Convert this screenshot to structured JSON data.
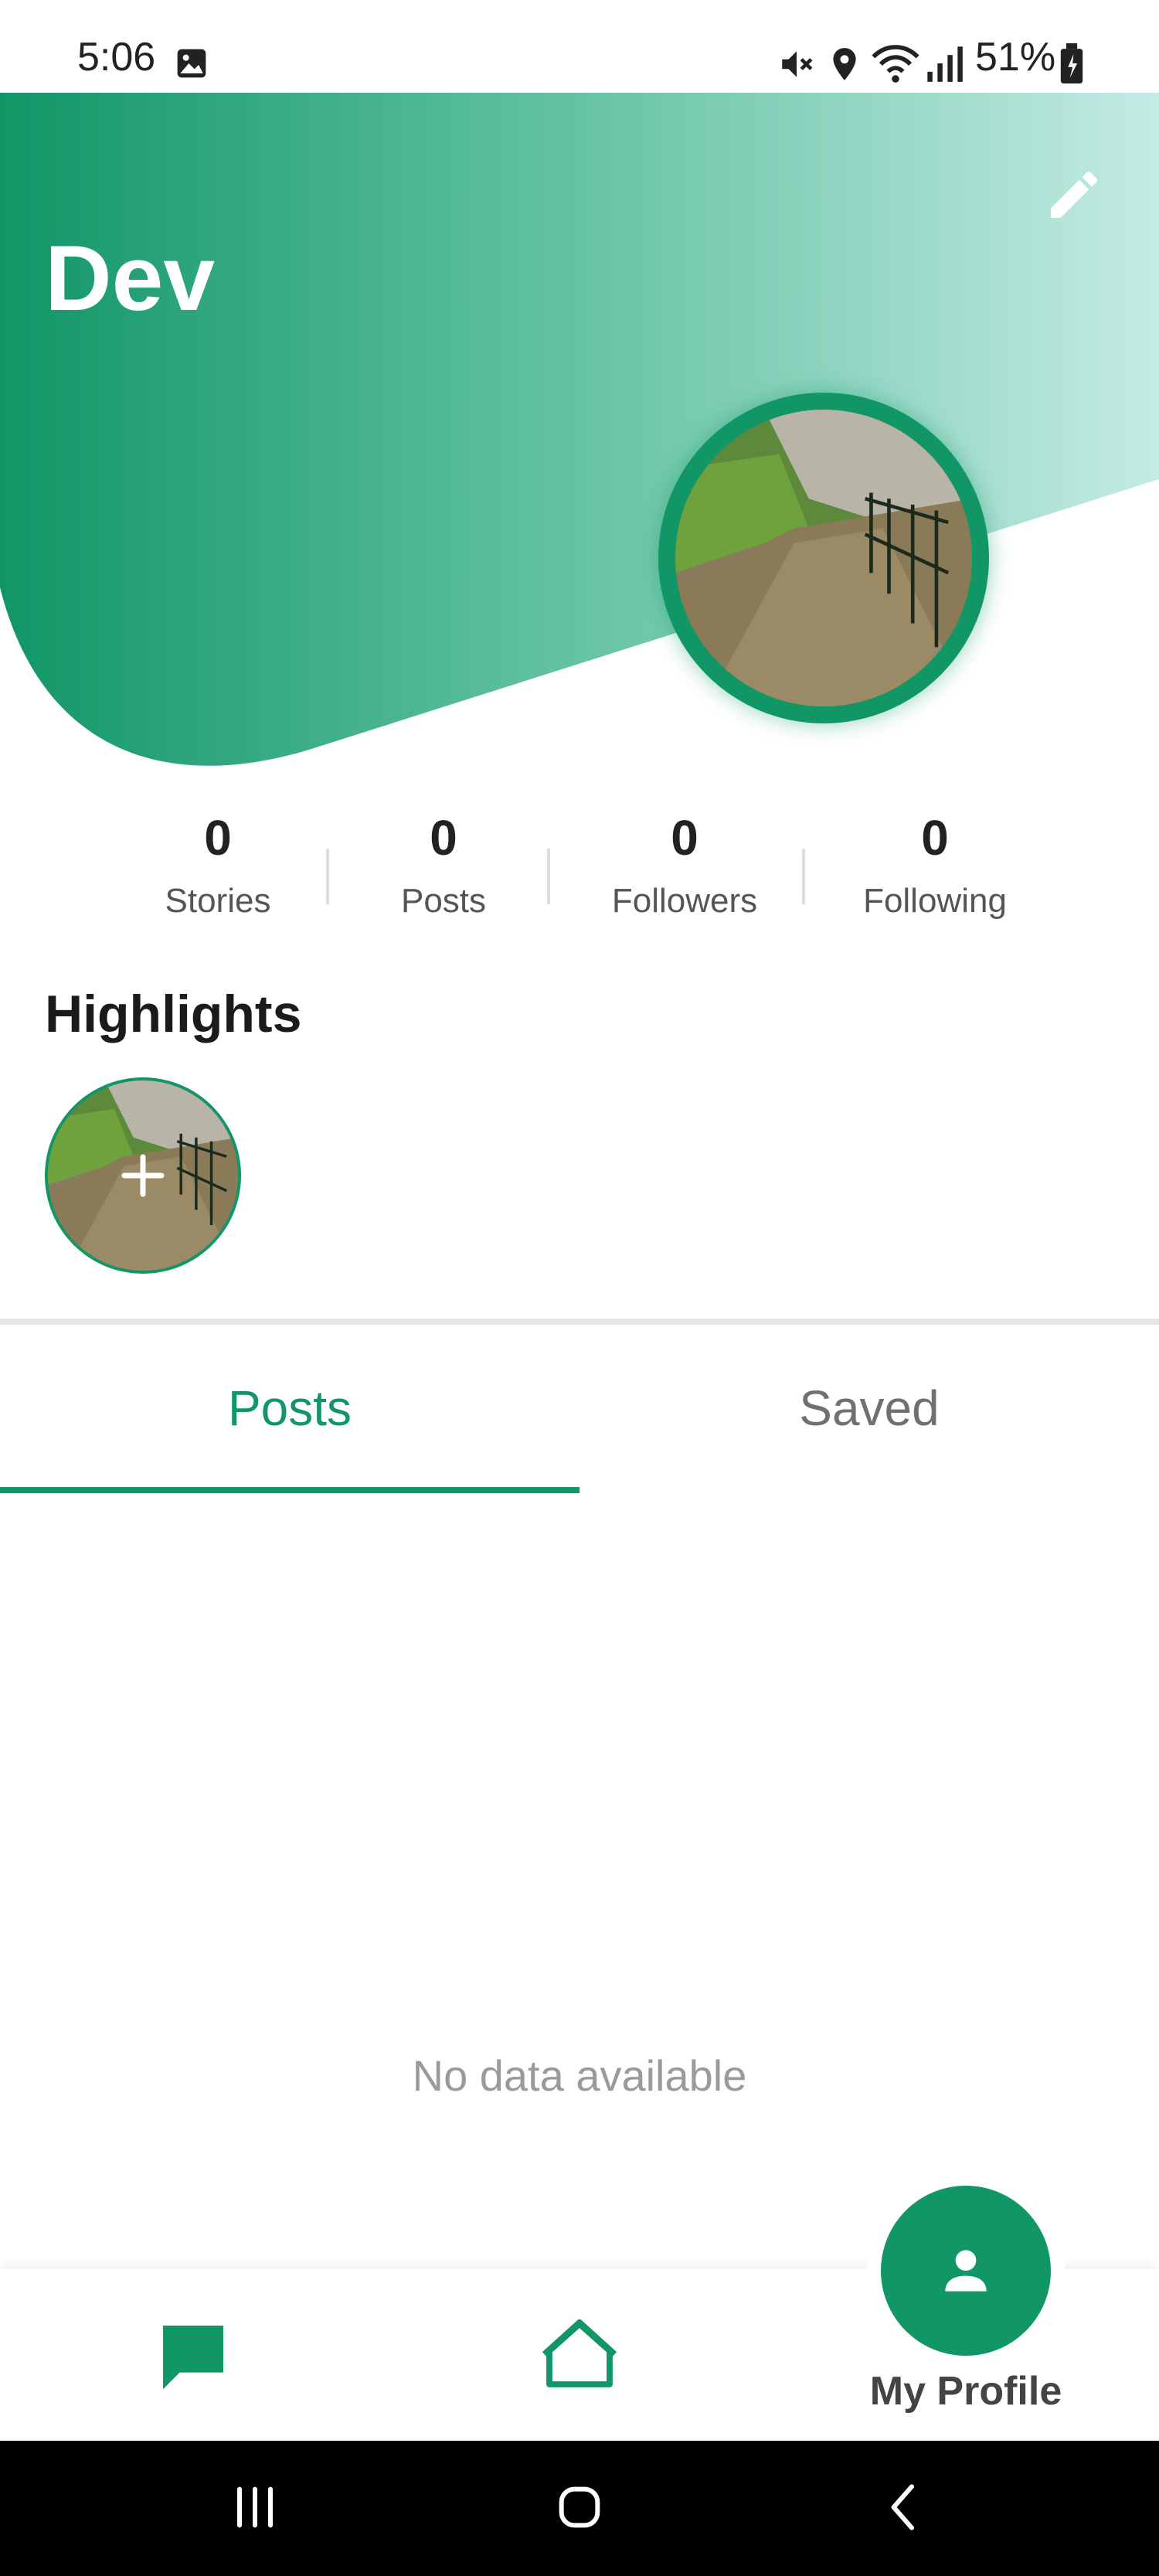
{
  "status_bar": {
    "time": "5:06",
    "battery": "51%",
    "icons": [
      "gallery-icon",
      "mute-icon",
      "location-icon",
      "wifi-icon",
      "signal-icon",
      "battery-icon"
    ]
  },
  "profile": {
    "name": "Dev",
    "edit_icon": "pencil-icon"
  },
  "stats": [
    {
      "count": "0",
      "label": "Stories"
    },
    {
      "count": "0",
      "label": "Posts"
    },
    {
      "count": "0",
      "label": "Followers"
    },
    {
      "count": "0",
      "label": "Following"
    }
  ],
  "highlights": {
    "title": "Highlights",
    "add_icon": "plus-icon"
  },
  "tabs": [
    {
      "label": "Posts",
      "selected": true
    },
    {
      "label": "Saved",
      "selected": false
    }
  ],
  "content": {
    "empty_message": "No data available"
  },
  "bottom_nav": {
    "items": [
      {
        "icon": "chat-icon"
      },
      {
        "icon": "home-icon"
      },
      {
        "icon": "person-icon",
        "label": "My Profile"
      }
    ]
  },
  "colors": {
    "accent": "#119666",
    "header_gradient_end": "#c4ebe4"
  }
}
